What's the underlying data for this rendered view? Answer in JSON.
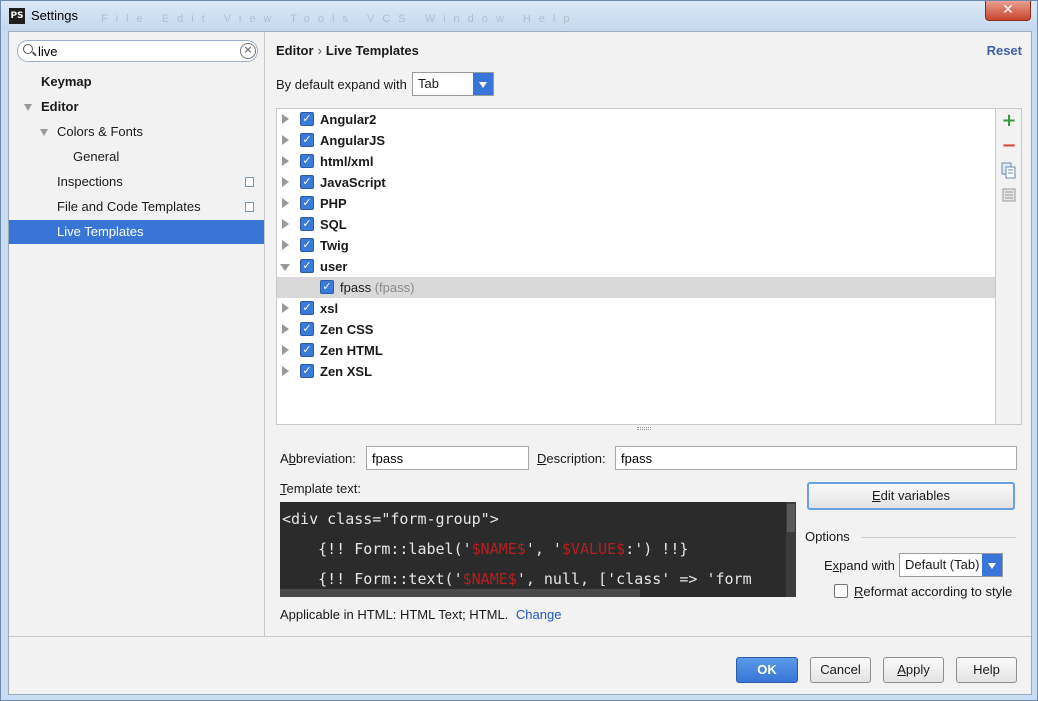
{
  "window": {
    "title": "Settings",
    "app_icon": "PS",
    "close": "✕",
    "ghost_menu": "File Edit View Tools VCS Window Help"
  },
  "search": {
    "value": "live"
  },
  "nav": [
    {
      "label": "Keymap"
    },
    {
      "label": "Editor"
    },
    {
      "label": "Colors & Fonts"
    },
    {
      "label": "General"
    },
    {
      "label": "Inspections"
    },
    {
      "label": "File and Code Templates"
    },
    {
      "label": "Live Templates"
    }
  ],
  "header": {
    "crumb1": "Editor",
    "sep": "›",
    "crumb2": "Live Templates",
    "reset": "Reset"
  },
  "expand": {
    "label": "By default expand with",
    "value": "Tab"
  },
  "tree": [
    {
      "label": "Angular2"
    },
    {
      "label": "AngularJS"
    },
    {
      "label": "html/xml"
    },
    {
      "label": "JavaScript"
    },
    {
      "label": "PHP"
    },
    {
      "label": "SQL"
    },
    {
      "label": "Twig"
    },
    {
      "label": "user"
    },
    {
      "label": "fpass",
      "sub": "(fpass)"
    },
    {
      "label": "xsl"
    },
    {
      "label": "Zen CSS"
    },
    {
      "label": "Zen HTML"
    },
    {
      "label": "Zen XSL"
    }
  ],
  "tools": {
    "add": "+",
    "remove": "−"
  },
  "abbreviation": {
    "label_pre": "A",
    "label_u": "b",
    "label_post": "breviation:",
    "value": "fpass"
  },
  "description": {
    "label_u": "D",
    "label_post": "escription:",
    "value": "fpass"
  },
  "template_text": {
    "label_u": "T",
    "label_post": "emplate text:"
  },
  "code": {
    "line1": "<div class=\"form-group\">",
    "line2_pre": "    {!! Form::label('",
    "line2_var1": "$NAME$",
    "line2_mid": "', '",
    "line2_var2": "$VALUE$",
    "line2_post": ":') !!}",
    "line3_pre": "    {!! Form::text('",
    "line3_var": "$NAME$",
    "line3_post": "', null, ['class' => 'form"
  },
  "edit_variables": {
    "label_u": "E",
    "label_post": "dit variables"
  },
  "options": {
    "title": "Options",
    "expand_label_pre": "E",
    "expand_label_u": "x",
    "expand_label_post": "pand with",
    "expand_value": "Default (Tab)",
    "reformat_u": "R",
    "reformat_post": "eformat according to style"
  },
  "applicable": {
    "text": "Applicable in HTML: HTML Text; HTML.",
    "link": "Change"
  },
  "buttons": {
    "ok": "OK",
    "cancel": "Cancel",
    "apply_u": "A",
    "apply_post": "pply",
    "help": "Help"
  }
}
